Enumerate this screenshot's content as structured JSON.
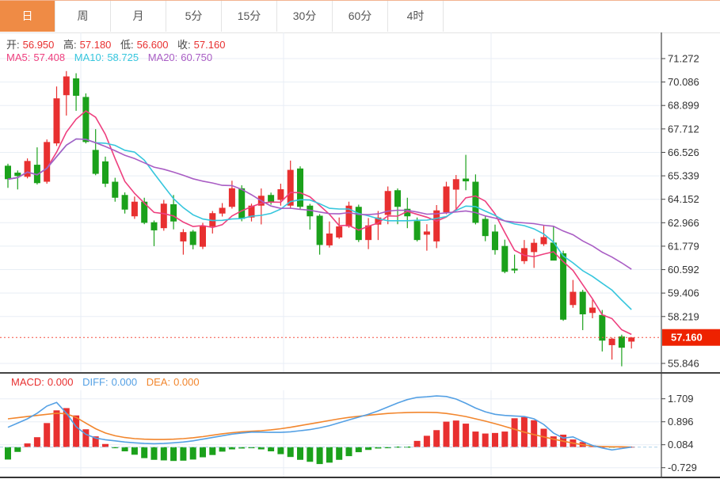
{
  "header": {
    "tabs": [
      {
        "label": "日",
        "active": true
      },
      {
        "label": "周",
        "active": false
      },
      {
        "label": "月",
        "active": false
      },
      {
        "label": "5分",
        "active": false
      },
      {
        "label": "15分",
        "active": false
      },
      {
        "label": "30分",
        "active": false
      },
      {
        "label": "60分",
        "active": false
      },
      {
        "label": "4时",
        "active": false
      }
    ]
  },
  "quote_bar": {
    "open_label": "开:",
    "open_value": "56.950",
    "high_label": "高:",
    "high_value": "57.180",
    "low_label": "低:",
    "low_value": "56.600",
    "close_label": "收:",
    "close_value": "57.160"
  },
  "ma_bar": {
    "ma5_label": "MA5:",
    "ma5_value": "57.408",
    "ma10_label": "MA10:",
    "ma10_value": "58.725",
    "ma20_label": "MA20:",
    "ma20_value": "60.750"
  },
  "macd_bar": {
    "macd_label": "MACD:",
    "macd_value": "0.000",
    "diff_label": "DIFF:",
    "diff_value": "0.000",
    "dea_label": "DEA:",
    "dea_value": "0.000"
  },
  "colors": {
    "up": "#e83030",
    "down": "#1ba11b",
    "ma5": "#ee3f7e",
    "ma10": "#36c6dd",
    "ma20": "#a95dc4",
    "diff": "#54a0e4",
    "dea": "#f2862d",
    "tab_active_bg": "#ef8b45",
    "badge_bg": "#ee2200",
    "grid": "#e8eef5",
    "axis": "#444444",
    "text": "#333333",
    "dotted": "#f55140",
    "zero_dash": "#a9cfe8"
  },
  "chart_data": [
    {
      "type": "candlestick",
      "title": "daily-kline",
      "candle_format": [
        "open",
        "high",
        "low",
        "close"
      ],
      "y_ticks": [
        71.272,
        70.086,
        68.899,
        67.712,
        66.526,
        65.339,
        64.152,
        62.966,
        61.779,
        60.592,
        59.406,
        58.219,
        55.846
      ],
      "ylim": [
        55.365,
        72.594
      ],
      "x_gridlines": [
        102,
        358,
        620
      ],
      "grid": true,
      "current_price": 57.16,
      "current_price_label": "57.160",
      "ma_periods": [
        5,
        10,
        20
      ],
      "candles": [
        [
          65.85,
          65.95,
          64.73,
          65.17
        ],
        [
          65.5,
          65.61,
          64.65,
          65.33
        ],
        [
          65.29,
          66.22,
          65.21,
          66.09
        ],
        [
          65.9,
          66.78,
          64.9,
          64.97
        ],
        [
          65.04,
          67.18,
          64.94,
          67.05
        ],
        [
          66.98,
          69.86,
          66.85,
          69.26
        ],
        [
          69.42,
          70.64,
          68.39,
          70.37
        ],
        [
          70.27,
          70.53,
          68.63,
          69.39
        ],
        [
          69.33,
          69.51,
          66.98,
          67.05
        ],
        [
          66.65,
          67.7,
          65.37,
          65.44
        ],
        [
          66.07,
          66.31,
          64.77,
          64.94
        ],
        [
          65.04,
          65.24,
          64.03,
          64.23
        ],
        [
          64.37,
          64.5,
          63.43,
          63.63
        ],
        [
          63.29,
          64.29,
          63.16,
          64.03
        ],
        [
          64.03,
          64.23,
          62.89,
          62.96
        ],
        [
          62.99,
          63.08,
          61.78,
          62.58
        ],
        [
          62.69,
          64.12,
          62.56,
          63.93
        ],
        [
          63.9,
          64.37,
          62.63,
          63.03
        ],
        [
          62.02,
          62.64,
          61.35,
          62.49
        ],
        [
          62.52,
          62.6,
          61.62,
          61.84
        ],
        [
          61.75,
          62.96,
          61.63,
          62.82
        ],
        [
          62.78,
          63.56,
          62.42,
          63.45
        ],
        [
          63.43,
          63.96,
          63.28,
          63.72
        ],
        [
          63.77,
          65.09,
          63.68,
          64.71
        ],
        [
          64.71,
          64.86,
          63.04,
          63.16
        ],
        [
          63.23,
          63.93,
          63.03,
          63.83
        ],
        [
          63.83,
          64.7,
          62.88,
          64.33
        ],
        [
          64.37,
          64.49,
          63.88,
          64.03
        ],
        [
          64.12,
          64.94,
          63.83,
          64.66
        ],
        [
          63.83,
          66.11,
          63.69,
          65.64
        ],
        [
          65.71,
          65.82,
          63.63,
          63.77
        ],
        [
          63.83,
          63.92,
          62.62,
          63.29
        ],
        [
          63.32,
          63.4,
          61.35,
          61.84
        ],
        [
          61.82,
          63.03,
          61.71,
          62.42
        ],
        [
          62.22,
          63.23,
          62.15,
          62.78
        ],
        [
          62.78,
          64.03,
          62.71,
          63.83
        ],
        [
          63.77,
          63.88,
          61.99,
          62.09
        ],
        [
          62.09,
          63.2,
          61.63,
          62.83
        ],
        [
          62.87,
          63.56,
          62.09,
          63.23
        ],
        [
          63.36,
          64.8,
          62.89,
          64.57
        ],
        [
          64.61,
          64.7,
          62.89,
          63.77
        ],
        [
          63.67,
          64.23,
          62.69,
          63.29
        ],
        [
          63.05,
          63.23,
          62.02,
          62.09
        ],
        [
          62.36,
          62.89,
          61.55,
          62.52
        ],
        [
          62.02,
          63.86,
          61.68,
          63.59
        ],
        [
          63.49,
          65.04,
          63.4,
          64.8
        ],
        [
          64.64,
          65.38,
          63.56,
          65.17
        ],
        [
          65.2,
          66.4,
          64.61,
          65.06
        ],
        [
          65.04,
          65.41,
          62.88,
          62.96
        ],
        [
          63.16,
          63.28,
          62.03,
          62.29
        ],
        [
          62.52,
          62.87,
          61.35,
          61.58
        ],
        [
          61.79,
          62.11,
          60.41,
          60.48
        ],
        [
          60.64,
          61.35,
          60.41,
          60.55
        ],
        [
          61.02,
          62.09,
          60.88,
          61.68
        ],
        [
          61.48,
          62.15,
          60.68,
          61.95
        ],
        [
          61.88,
          62.82,
          61.79,
          62.24
        ],
        [
          61.96,
          62.78,
          61.18,
          61.05
        ],
        [
          61.42,
          61.55,
          58.0,
          58.06
        ],
        [
          58.8,
          60.07,
          58.66,
          59.47
        ],
        [
          59.47,
          59.57,
          57.53,
          58.33
        ],
        [
          58.4,
          59.07,
          58.13,
          58.67
        ],
        [
          58.3,
          58.55,
          56.45,
          57.0
        ],
        [
          56.77,
          57.15,
          56.04,
          57.1
        ],
        [
          57.21,
          57.3,
          55.7,
          56.64
        ],
        [
          56.95,
          57.18,
          56.6,
          57.16
        ]
      ]
    },
    {
      "type": "bar",
      "title": "MACD",
      "y_ticks": [
        1.709,
        0.896,
        0.084,
        -0.729
      ],
      "ylim": [
        -1.1,
        2.57
      ],
      "histogram": [
        -0.44,
        -0.17,
        0.13,
        0.35,
        0.85,
        1.3,
        1.38,
        1.12,
        0.63,
        0.38,
        0.11,
        -0.04,
        -0.15,
        -0.27,
        -0.39,
        -0.45,
        -0.47,
        -0.49,
        -0.48,
        -0.44,
        -0.36,
        -0.28,
        -0.16,
        -0.08,
        -0.05,
        -0.04,
        -0.08,
        -0.15,
        -0.25,
        -0.35,
        -0.45,
        -0.52,
        -0.6,
        -0.55,
        -0.45,
        -0.32,
        -0.18,
        -0.1,
        -0.05,
        -0.04,
        -0.03,
        -0.02,
        0.22,
        0.4,
        0.6,
        0.9,
        0.94,
        0.83,
        0.55,
        0.48,
        0.5,
        0.55,
        1.02,
        1.06,
        0.95,
        0.65,
        0.38,
        0.44,
        0.27,
        0.18,
        0.06,
        0.02,
        -0.01,
        0.0,
        0.0
      ],
      "series": [
        {
          "name": "DIFF",
          "color_key": "diff",
          "values": [
            0.7,
            0.85,
            1.0,
            1.2,
            1.45,
            1.58,
            1.2,
            0.72,
            0.45,
            0.32,
            0.26,
            0.22,
            0.18,
            0.15,
            0.13,
            0.12,
            0.13,
            0.15,
            0.18,
            0.22,
            0.28,
            0.34,
            0.4,
            0.46,
            0.5,
            0.53,
            0.53,
            0.52,
            0.52,
            0.54,
            0.58,
            0.62,
            0.68,
            0.76,
            0.86,
            0.96,
            1.06,
            1.16,
            1.28,
            1.42,
            1.56,
            1.68,
            1.76,
            1.78,
            1.81,
            1.79,
            1.7,
            1.55,
            1.38,
            1.25,
            1.16,
            1.12,
            1.1,
            1.08,
            1.0,
            0.8,
            0.5,
            0.32,
            0.36,
            0.2,
            0.06,
            -0.03,
            -0.1,
            -0.05,
            0.0
          ]
        },
        {
          "name": "DEA",
          "color_key": "dea",
          "values": [
            1.0,
            1.04,
            1.08,
            1.12,
            1.16,
            1.2,
            1.18,
            1.05,
            0.85,
            0.65,
            0.5,
            0.4,
            0.34,
            0.3,
            0.28,
            0.27,
            0.27,
            0.28,
            0.3,
            0.33,
            0.37,
            0.42,
            0.47,
            0.51,
            0.54,
            0.56,
            0.58,
            0.61,
            0.65,
            0.7,
            0.76,
            0.82,
            0.88,
            0.94,
            1.0,
            1.05,
            1.09,
            1.13,
            1.16,
            1.19,
            1.21,
            1.22,
            1.23,
            1.23,
            1.22,
            1.19,
            1.14,
            1.08,
            1.0,
            0.92,
            0.83,
            0.73,
            0.63,
            0.53,
            0.44,
            0.36,
            0.28,
            0.21,
            0.14,
            0.08,
            0.04,
            0.02,
            0.01,
            0.01,
            0.0
          ]
        }
      ]
    }
  ]
}
